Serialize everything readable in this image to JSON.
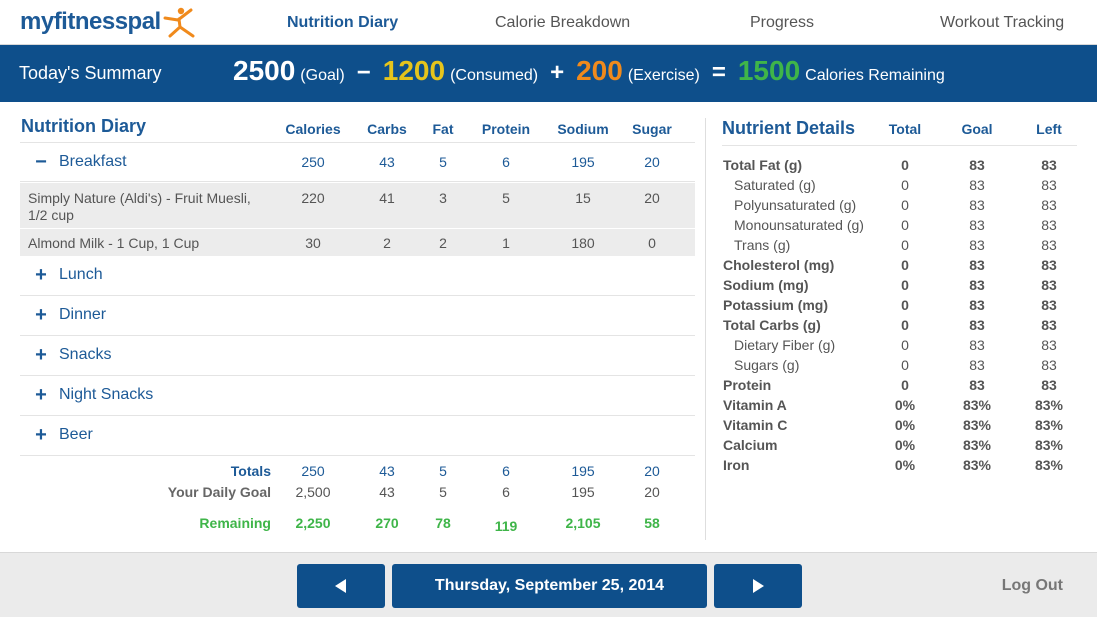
{
  "header": {
    "logo_text": "myfitnesspal",
    "tabs": [
      {
        "label": "Nutrition Diary",
        "active": true
      },
      {
        "label": "Calorie Breakdown",
        "active": false
      },
      {
        "label": "Progress",
        "active": false
      },
      {
        "label": "Workout Tracking",
        "active": false
      }
    ]
  },
  "summary": {
    "title": "Today's Summary",
    "goal_value": "2500",
    "goal_label": "(Goal)",
    "minus": "−",
    "consumed_value": "1200",
    "consumed_label": "(Consumed)",
    "plus": "+",
    "exercise_value": "200",
    "exercise_label": "(Exercise)",
    "equals": "=",
    "remaining_value": "1500",
    "remaining_label": "Calories Remaining"
  },
  "diary": {
    "title": "Nutrition Diary",
    "columns": [
      "Calories",
      "Carbs",
      "Fat",
      "Protein",
      "Sodium",
      "Sugar"
    ],
    "breakfast": {
      "sign": "−",
      "name": "Breakfast",
      "values": [
        "250",
        "43",
        "5",
        "6",
        "195",
        "20"
      ],
      "foods": [
        {
          "name": "Simply Nature (Aldi's) - Fruit Muesli, 1/2 cup",
          "values": [
            "220",
            "41",
            "3",
            "5",
            "15",
            "20"
          ]
        },
        {
          "name": "Almond Milk - 1 Cup, 1 Cup",
          "values": [
            "30",
            "2",
            "2",
            "1",
            "180",
            "0"
          ]
        }
      ]
    },
    "collapsed_meals": [
      {
        "sign": "+",
        "name": "Lunch"
      },
      {
        "sign": "+",
        "name": "Dinner"
      },
      {
        "sign": "+",
        "name": "Snacks"
      },
      {
        "sign": "+",
        "name": "Night Snacks"
      },
      {
        "sign": "+",
        "name": "Beer"
      }
    ],
    "totals": {
      "label": "Totals",
      "values": [
        "250",
        "43",
        "5",
        "6",
        "195",
        "20"
      ]
    },
    "daily_goal": {
      "label": "Your Daily Goal",
      "values": [
        "2,500",
        "43",
        "5",
        "6",
        "195",
        "20"
      ]
    },
    "remaining": {
      "label": "Remaining",
      "values": [
        "2,250",
        "270",
        "78",
        "119",
        "2,105",
        "58"
      ]
    }
  },
  "nutrients": {
    "title": "Nutrient Details",
    "columns": [
      "Total",
      "Goal",
      "Left"
    ],
    "rows": [
      {
        "name": "Total Fat (g)",
        "style": "bold",
        "total": "0",
        "goal": "83",
        "left": "83"
      },
      {
        "name": "Saturated (g)",
        "style": "sub",
        "total": "0",
        "goal": "83",
        "left": "83"
      },
      {
        "name": "Polyunsaturated (g)",
        "style": "sub",
        "total": "0",
        "goal": "83",
        "left": "83"
      },
      {
        "name": "Monounsaturated (g)",
        "style": "sub",
        "total": "0",
        "goal": "83",
        "left": "83"
      },
      {
        "name": "Trans (g)",
        "style": "sub",
        "total": "0",
        "goal": "83",
        "left": "83"
      },
      {
        "name": "Cholesterol (mg)",
        "style": "bold",
        "total": "0",
        "goal": "83",
        "left": "83"
      },
      {
        "name": "Sodium (mg)",
        "style": "bold",
        "total": "0",
        "goal": "83",
        "left": "83"
      },
      {
        "name": "Potassium (mg)",
        "style": "bold",
        "total": "0",
        "goal": "83",
        "left": "83"
      },
      {
        "name": "Total Carbs (g)",
        "style": "bold",
        "total": "0",
        "goal": "83",
        "left": "83"
      },
      {
        "name": "Dietary Fiber (g)",
        "style": "sub",
        "total": "0",
        "goal": "83",
        "left": "83"
      },
      {
        "name": "Sugars (g)",
        "style": "sub",
        "total": "0",
        "goal": "83",
        "left": "83"
      },
      {
        "name": "Protein",
        "style": "bold",
        "total": "0",
        "goal": "83",
        "left": "83"
      },
      {
        "name": "Vitamin A",
        "style": "bold",
        "total": "0%",
        "goal": "83%",
        "left": "83%"
      },
      {
        "name": "Vitamin C",
        "style": "bold",
        "total": "0%",
        "goal": "83%",
        "left": "83%"
      },
      {
        "name": "Calcium",
        "style": "bold",
        "total": "0%",
        "goal": "83%",
        "left": "83%"
      },
      {
        "name": "Iron",
        "style": "bold",
        "total": "0%",
        "goal": "83%",
        "left": "83%"
      }
    ]
  },
  "footer": {
    "prev_icon": "triangle-left-icon",
    "date": "Thursday, September 25, 2014",
    "next_icon": "triangle-right-icon",
    "logout": "Log Out"
  },
  "colors": {
    "brand_blue": "#0e4f8b",
    "link_blue": "#1d5a97",
    "consumed_yellow": "#e5c41c",
    "exercise_orange": "#f08a1c",
    "remaining_green": "#3fb549"
  }
}
